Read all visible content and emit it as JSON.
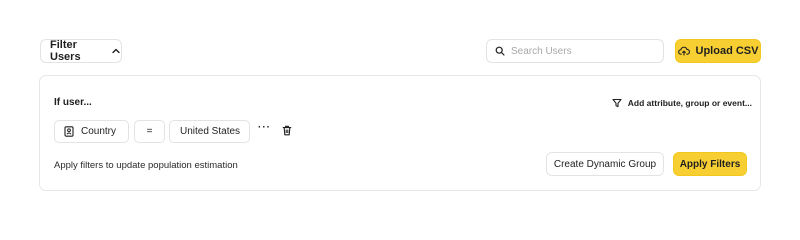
{
  "toolbar": {
    "filter_users_label": "Filter Users",
    "search_placeholder": "Search Users",
    "search_value": "",
    "upload_label": "Upload CSV"
  },
  "filter_panel": {
    "heading": "If user...",
    "add_attribute_label": "Add attribute, group or event...",
    "condition": {
      "attribute": "Country",
      "operator": "=",
      "value": "United States",
      "more": "···"
    },
    "estimation_text": "Apply filters to update population estimation",
    "create_group_label": "Create Dynamic Group",
    "apply_label": "Apply Filters"
  },
  "icons": {
    "filter_toggle": "chevron-up-icon",
    "search": "search-icon",
    "upload": "cloud-upload-icon",
    "add_attribute": "funnel-icon",
    "attribute": "contact-card-icon",
    "delete": "trash-icon"
  },
  "colors": {
    "accent": "#f7cf33",
    "border": "#e3e3e3",
    "text": "#1f1f1f",
    "placeholder": "#a8a8a8"
  }
}
